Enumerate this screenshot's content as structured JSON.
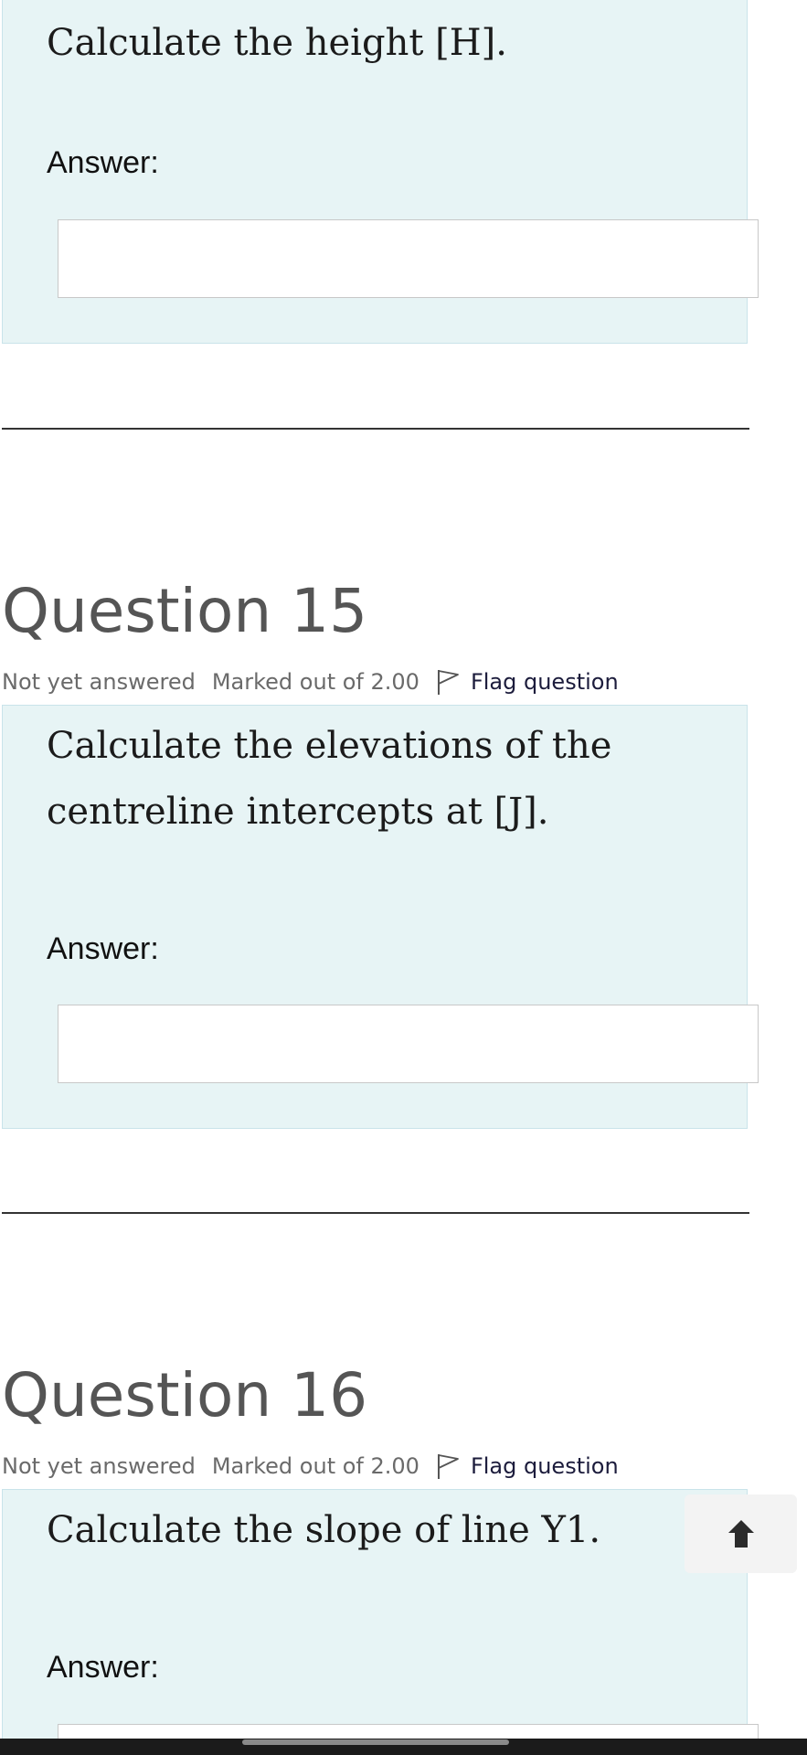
{
  "questions": [
    {
      "text": "Calculate the height [H].",
      "answer_label": "Answer:",
      "answer_value": ""
    },
    {
      "title": "Question 15",
      "state": "Not yet answered",
      "grade": "Marked out of 2.00",
      "flag_label": "Flag question",
      "text": "Calculate the elevations of the centreline intercepts at [J].",
      "answer_label": "Answer:",
      "answer_value": ""
    },
    {
      "title": "Question 16",
      "state": "Not yet answered",
      "grade": "Marked out of 2.00",
      "flag_label": "Flag question",
      "text": "Calculate the slope of line Y1.",
      "answer_label": "Answer:",
      "answer_value": ""
    }
  ],
  "icons": {
    "flag": "flag-icon",
    "back_to_top": "arrow-up-icon"
  }
}
